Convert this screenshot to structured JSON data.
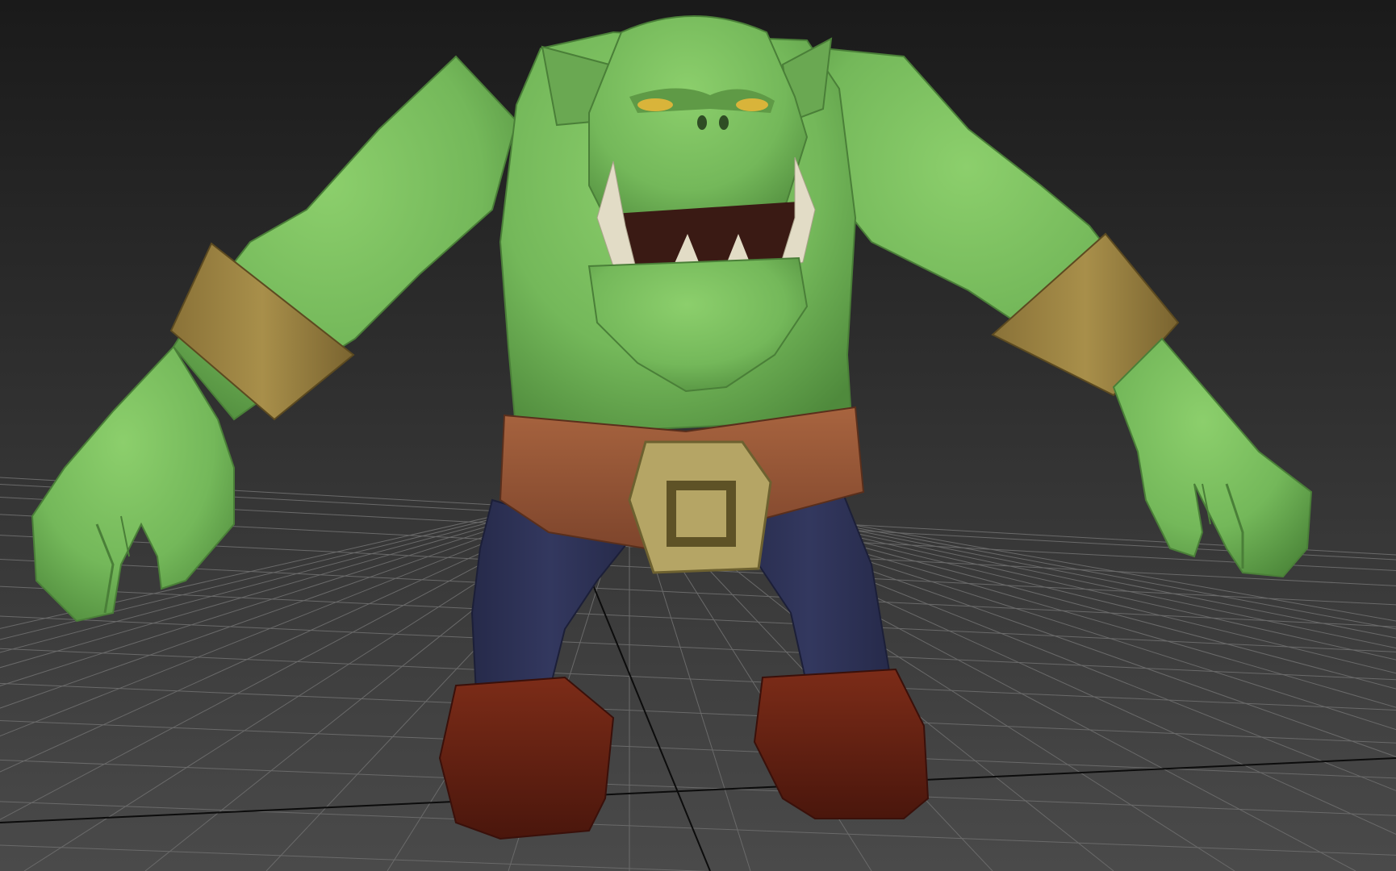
{
  "viewport": {
    "background_top": "#1a1a1a",
    "background_bottom": "#4a4a4a",
    "grid_color": "#6a6a6a",
    "axis_color": "#0c0c0c"
  },
  "model": {
    "skin_color": "#74b85a",
    "skin_shadow": "#4f8a3c",
    "skin_highlight": "#8ccf6c",
    "wristband_color": "#a38a45",
    "belt_color": "#9b5a3a",
    "buckle_color": "#b5a565",
    "pants_color": "#2f3358",
    "boot_color": "#6e2615",
    "tusk_color": "#e2dcc6",
    "mouth_color": "#3a1a14",
    "eye_color": "#d9b43a"
  }
}
